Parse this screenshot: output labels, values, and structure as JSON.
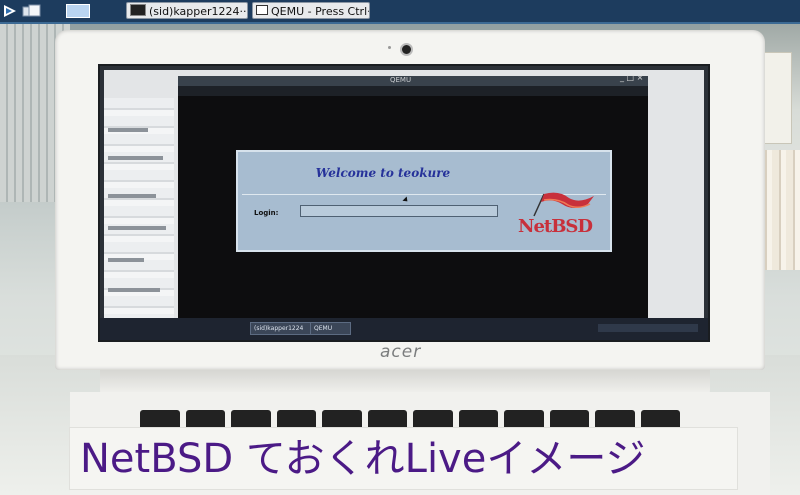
{
  "host_taskbar": {
    "window_button_1": "(sid)kapper1224···",
    "window_button_2": "QEMU - Press Ctrl···"
  },
  "photo": {
    "laptop_brand": "acer",
    "qemu_window_title": "QEMU",
    "login_dialog": {
      "welcome": "Welcome to teokure",
      "login_label": "Login:",
      "logo_text": "NetBSD"
    },
    "inner_taskbar": {
      "task_1": "(sid)kapper1224",
      "task_2": "QEMU"
    }
  },
  "caption": "NetBSD ておくれLiveイメージ",
  "colors": {
    "caption_text": "#4b1a86",
    "dialog_bg": "#a7bcd0",
    "welcome_text": "#26329a",
    "netbsd_red": "#c8303b"
  }
}
